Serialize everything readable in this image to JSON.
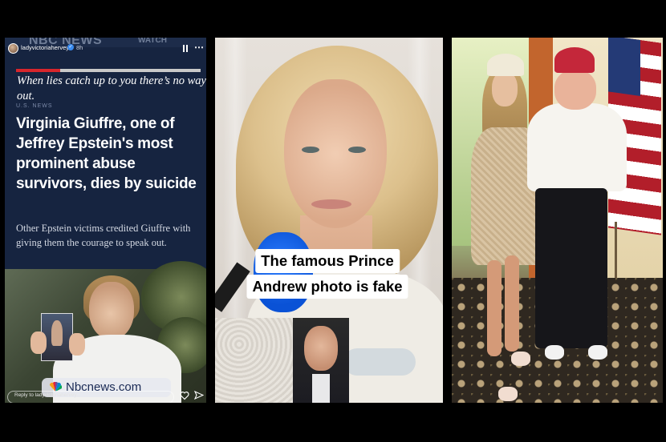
{
  "story": {
    "source_label": "NBC NEWS",
    "watch_label": "WATCH",
    "username": "ladyvictoriahervey",
    "verified_icon": "verified-badge-icon",
    "time_ago": "8h",
    "progress": 0.24,
    "caption": "When lies catch up to you there’s no way out.",
    "section": "U.S. NEWS",
    "headline": "Virginia Giuffre, one of Jeffrey Epstein's most prominent abuse survivors, dies by suicide",
    "dek": "Other Epstein victims credited Giuffre with giving them the courage to speak out.",
    "watermark_domain": "Nbcnews.com",
    "reply_placeholder": "Reply to ladyvictoriahervey..."
  },
  "interview": {
    "caption_line1": "The famous Prince",
    "caption_line2": "Andrew photo is fake"
  },
  "colors": {
    "story_bg": "#162440",
    "progress_red": "#d8262c",
    "mic_blue": "#0a52d6",
    "flag_red": "#b21e2a",
    "flag_blue": "#243a76"
  }
}
